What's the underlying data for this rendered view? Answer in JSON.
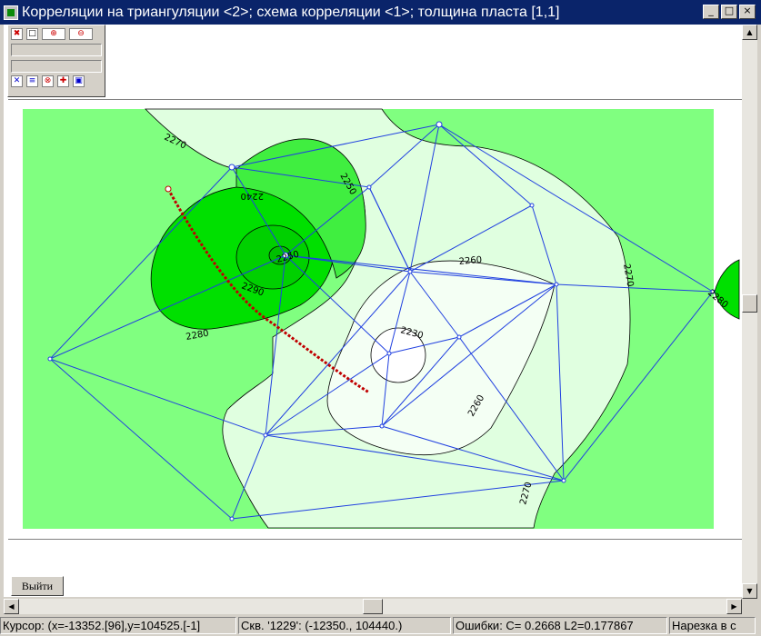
{
  "window": {
    "title": "Корреляции на триангуляции <2>; схема корреляции <1>; толщина пласта [1,1]",
    "minimize": "_",
    "maximize": "□",
    "close": "×"
  },
  "toolbar": {
    "row1": [
      {
        "icon": "x-red-icon",
        "glyph": "✖"
      },
      {
        "icon": "square-icon",
        "glyph": "□"
      },
      {
        "icon": "zoom-in-icon",
        "glyph": "⊕"
      },
      {
        "icon": "zoom-out-icon",
        "glyph": "⊖"
      }
    ],
    "row2": [
      {
        "icon": "close-box-icon",
        "glyph": "✕"
      },
      {
        "icon": "document-icon",
        "glyph": "≡"
      },
      {
        "icon": "no-icon",
        "glyph": "⊗"
      },
      {
        "icon": "target-icon",
        "glyph": "✚"
      },
      {
        "icon": "map-icon",
        "glyph": "▣"
      }
    ]
  },
  "map": {
    "contour_labels": [
      "2270",
      "2250",
      "2240",
      "2290",
      "2280",
      "2260",
      "2230",
      "2270",
      "2260",
      "2250",
      "2270",
      "2280"
    ],
    "colors": {
      "background_green": "#80ff80",
      "light_green": "#e0ffe0",
      "lightest_green": "#f4fff4",
      "dark_green": "#00e000",
      "medium_green": "#40ee40",
      "triangulation": "#2040e0",
      "profile_line": "#c00000"
    }
  },
  "exit_button": "Выйти",
  "status": {
    "cursor": "Курсор: (x=-13352.[96],y=104525.[-1]",
    "well": "Скв. '1229': (-12350., 104440.)",
    "errors": "Ошибки: C=  0.2668 L2=0.177867",
    "slicing": "Нарезка в с"
  }
}
